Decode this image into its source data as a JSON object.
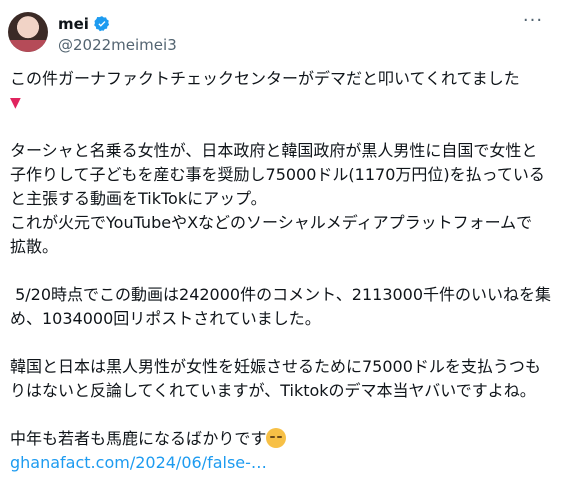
{
  "author": {
    "display_name": "mei",
    "handle": "@2022meimei3"
  },
  "menu": {
    "more_label": "···"
  },
  "tweet": {
    "line1": "この件ガーナファクトチェックセンターがデマだと叩いてくれてました",
    "heart": "▼",
    "para2_line1": "ターシャと名乗る女性が、日本政府と韓国政府が黒人男性に自国で女性と",
    "para2_line2": "子作りして子どもを産む事を奨励し75000ドル(1170万円位)を払っている",
    "para2_line3": "と主張する動画をTikTokにアップ。",
    "para2_line4": "これが火元でYouTubeやXなどのソーシャルメディアプラットフォームで",
    "para2_line5": "拡散。",
    "para3_line1": " 5/20時点でこの動画は242000件のコメント、2113000千件のいいねを集",
    "para3_line2": "め、1034000回リポストされていました。",
    "para4_line1": "韓国と日本は黒人男性が女性を妊娠させるために75000ドルを支払うつも",
    "para4_line2": "りはないと反論してくれていますが、Tiktokのデマ本当ヤバいですよね。",
    "para5_line1": "中年も若者も馬鹿になるばかりです",
    "link": "ghanafact.com/2024/06/false-…"
  },
  "colors": {
    "text": "#0f1419",
    "secondary": "#536471",
    "link": "#1d9bf0",
    "verified": "#1d9bf0"
  },
  "icons": {
    "verified": "verified-badge-icon",
    "more": "more-options-icon",
    "emoji": "pensive-face-emoji"
  }
}
